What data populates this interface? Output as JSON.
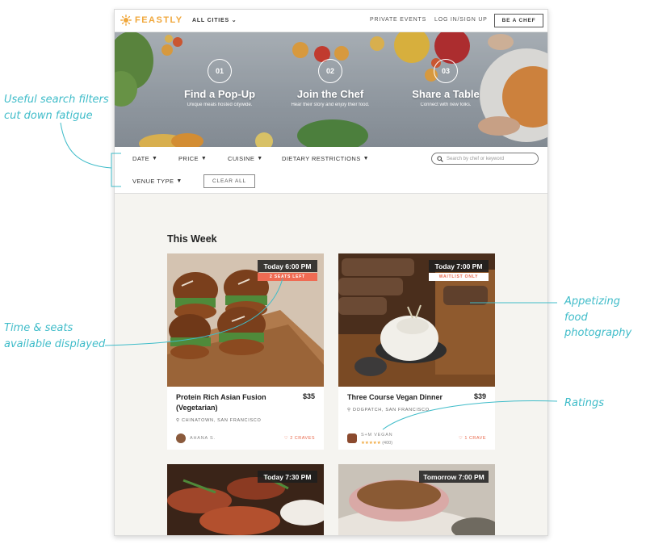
{
  "annotations": {
    "filters": "Useful search filters\ncut down fatigue",
    "time_seats": "Time & seats\navailable displayed",
    "photography": "Appetizing food\nphotography",
    "ratings": "Ratings"
  },
  "nav": {
    "logo": "FEASTLY",
    "city": "ALL CITIES",
    "private_events": "PRIVATE EVENTS",
    "login": "LOG IN/SIGN UP",
    "be_chef": "BE A CHEF"
  },
  "hero": {
    "steps": [
      {
        "num": "01",
        "title": "Find a Pop-Up",
        "sub": "Unique meals hosted citywide."
      },
      {
        "num": "02",
        "title": "Join the Chef",
        "sub": "Hear their story and enjoy their food."
      },
      {
        "num": "03",
        "title": "Share a Table",
        "sub": "Connect with new folks."
      }
    ]
  },
  "filters": {
    "date": "DATE",
    "price": "PRICE",
    "cuisine": "CUISINE",
    "dietary": "DIETARY RESTRICTIONS",
    "venue": "VENUE TYPE",
    "clear": "CLEAR ALL",
    "search_placeholder": "Search by chef or keyword"
  },
  "section_title": "This Week",
  "cards": [
    {
      "time": "Today 6:00 PM",
      "seats": "2 SEATS LEFT",
      "title": "Protein Rich Asian Fusion (Vegetarian)",
      "price": "$35",
      "location": "CHINATOWN, SAN FRANCISCO",
      "host": "AHANA S.",
      "crave": "2 CRAVES"
    },
    {
      "time": "Today 7:00 PM",
      "seats": "WAITLIST ONLY",
      "title": "Three Course Vegan Dinner",
      "price": "$39",
      "location": "DOGPATCH, SAN FRANCISCO",
      "host": "S+M VEGAN",
      "rating_count": "(400)",
      "crave": "1 CRAVE"
    },
    {
      "time": "Today 7:30 PM"
    },
    {
      "time": "Tomorrow 7:00 PM"
    }
  ],
  "colors": {
    "accent": "#3fbcc9",
    "brand": "#f0a73b",
    "alert": "#e8684b"
  }
}
